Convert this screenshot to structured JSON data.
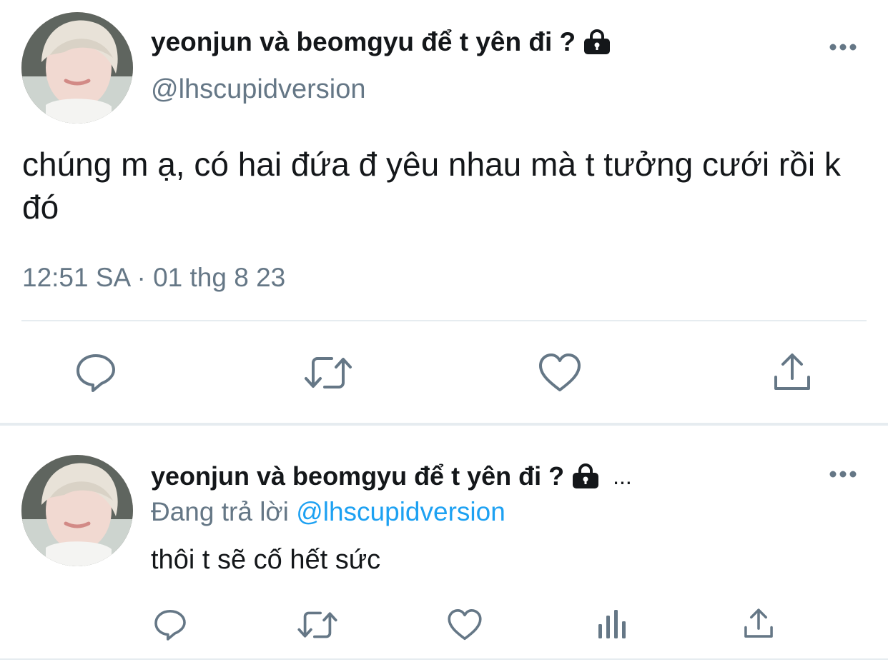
{
  "tweet": {
    "display_name": "yeonjun và beomgyu để t yên đi ?",
    "handle": "@lhscupidversion",
    "text": "chúng m ạ, có hai đứa đ yêu nhau mà t tưởng cưới rồi k đó",
    "timestamp": "12:51 SA · 01 thg 8 23",
    "icons": [
      "lock-icon",
      "more-icon",
      "reply-icon",
      "retweet-icon",
      "like-icon",
      "share-icon"
    ]
  },
  "reply": {
    "display_name": "yeonjun và beomgyu để t yên đi ?",
    "truncation": "...",
    "replying_prefix": "Đang trả lời",
    "replying_mention": "@lhscupidversion",
    "text": "thôi t sẽ cố hết sức",
    "icons": [
      "lock-icon",
      "more-icon",
      "reply-icon",
      "retweet-icon",
      "like-icon",
      "analytics-icon",
      "share-icon"
    ]
  },
  "colors": {
    "text": "#14171a",
    "secondary": "#657786",
    "mention": "#1da1f2",
    "divider": "#e6ecf0"
  }
}
